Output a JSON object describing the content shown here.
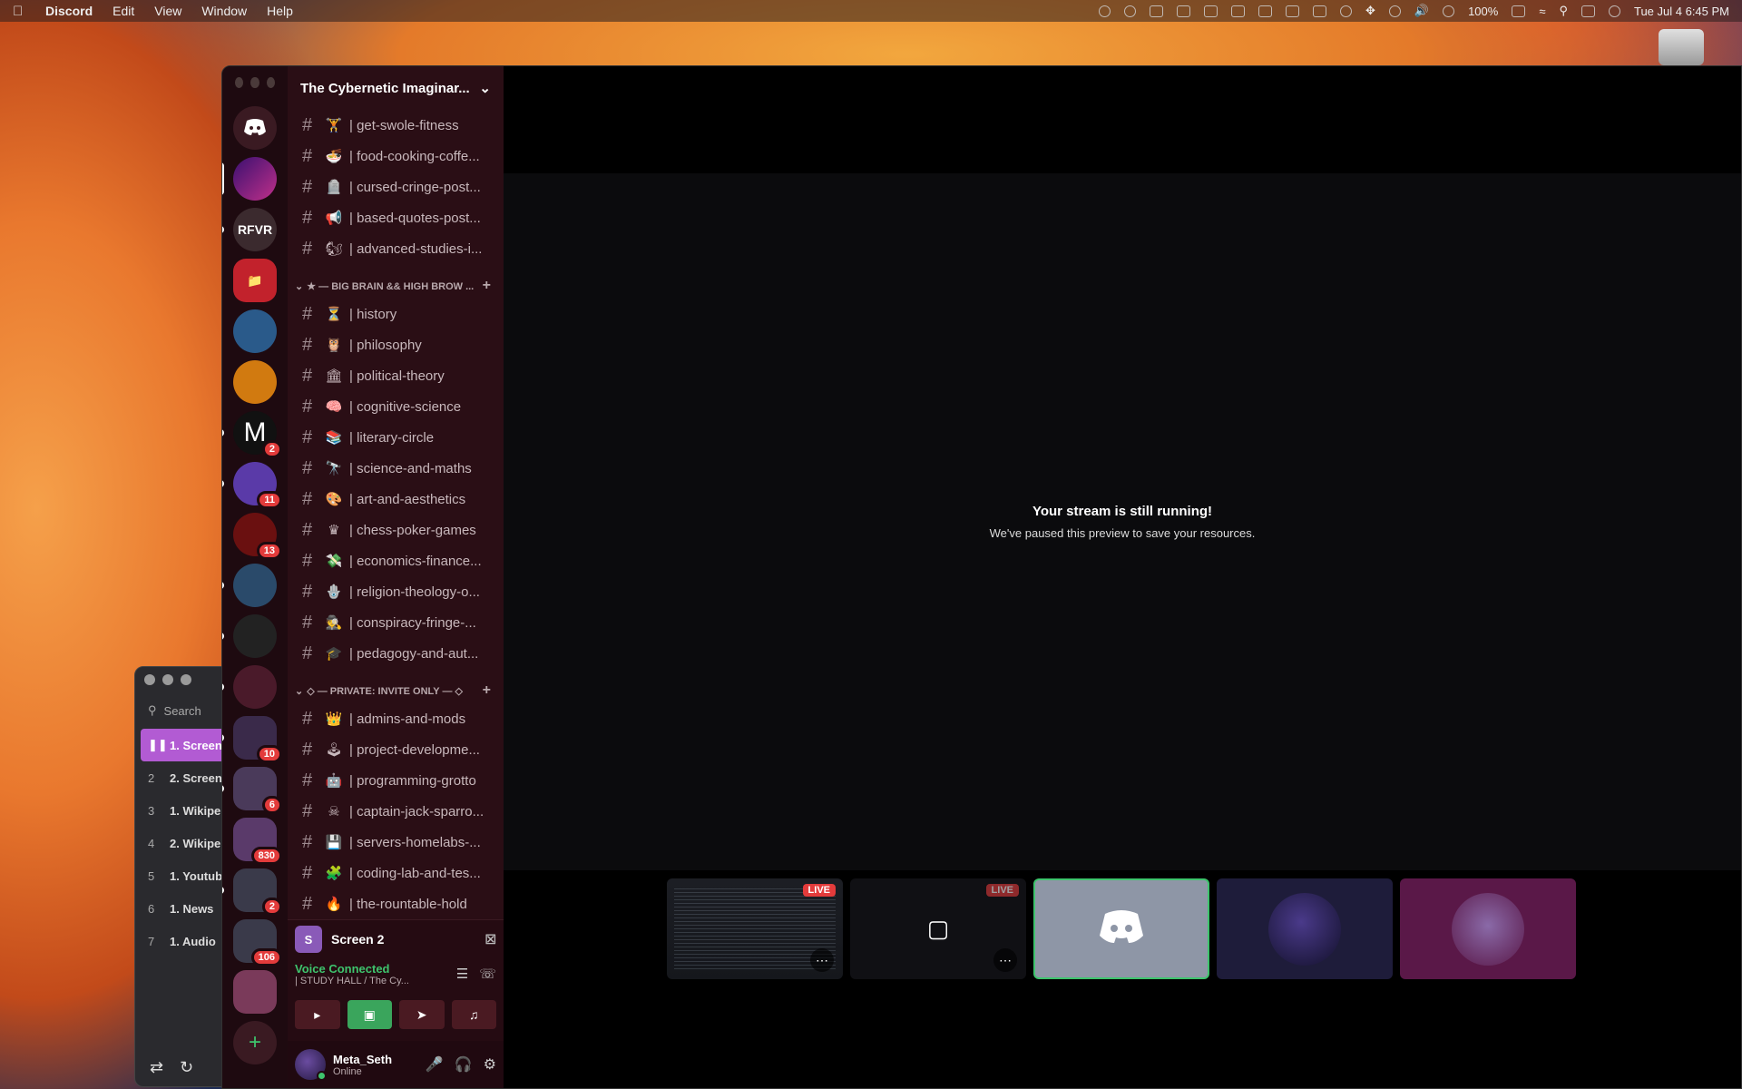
{
  "menubar": {
    "app_name": "Discord",
    "menus": [
      "Edit",
      "View",
      "Window",
      "Help"
    ],
    "battery": "100%",
    "clock": "Tue Jul 4  6:45 PM"
  },
  "music_player": {
    "search_placeholder": "Search",
    "tracks": [
      {
        "num": "",
        "name": "1. Screen",
        "active": true
      },
      {
        "num": "2",
        "name": "2. Screen"
      },
      {
        "num": "3",
        "name": "1. Wikipe"
      },
      {
        "num": "4",
        "name": "2. Wikipe"
      },
      {
        "num": "5",
        "name": "1. Youtub"
      },
      {
        "num": "6",
        "name": "1. News"
      },
      {
        "num": "7",
        "name": "1. Audio"
      }
    ]
  },
  "guilds": [
    {
      "label": "RFVR",
      "color": "#3b2a2e"
    },
    {
      "label": "",
      "color": "#c2222c",
      "icon": "folder"
    },
    {
      "label": "",
      "color": "#2a5a8a"
    },
    {
      "label": "",
      "color": "#d17a10"
    },
    {
      "label": "M",
      "color": "#111",
      "badge": "2"
    },
    {
      "label": "",
      "color": "#5a3aa8",
      "badge": "11"
    },
    {
      "label": "",
      "color": "#6a1010",
      "badge": "13"
    },
    {
      "label": "",
      "color": "#2a4a6a"
    },
    {
      "label": "",
      "color": "#222"
    },
    {
      "label": "",
      "color": "#4a1a2a"
    },
    {
      "label": "",
      "color": "#3a2a4a",
      "badge": "10"
    },
    {
      "label": "",
      "color": "#4a3a5a",
      "badge": "6"
    },
    {
      "label": "",
      "color": "#5a3a6a",
      "badge": "830"
    },
    {
      "label": "",
      "color": "#3a3a4a",
      "badge": "2"
    },
    {
      "label": "",
      "color": "#3a3a4a",
      "badge": "106"
    }
  ],
  "server": {
    "name": "The Cybernetic Imaginar...",
    "channels_top": [
      {
        "emoji": "🏋",
        "name": "| get-swole-fitness"
      },
      {
        "emoji": "🍜",
        "name": "| food-cooking-coffe..."
      },
      {
        "emoji": "🪦",
        "name": "| cursed-cringe-post..."
      },
      {
        "emoji": "📢",
        "name": "| based-quotes-post..."
      },
      {
        "emoji": "🐿",
        "name": "| advanced-studies-i..."
      }
    ],
    "category1": "★ — BIG BRAIN && HIGH BROW ...",
    "channels_mid": [
      {
        "emoji": "⏳",
        "name": "| history"
      },
      {
        "emoji": "🦉",
        "name": "| philosophy"
      },
      {
        "emoji": "🏛",
        "name": "| political-theory"
      },
      {
        "emoji": "🧠",
        "name": "| cognitive-science"
      },
      {
        "emoji": "📚",
        "name": "| literary-circle"
      },
      {
        "emoji": "🔭",
        "name": "| science-and-maths"
      },
      {
        "emoji": "🎨",
        "name": "| art-and-aesthetics"
      },
      {
        "emoji": "♛",
        "name": "| chess-poker-games"
      },
      {
        "emoji": "💸",
        "name": "| economics-finance..."
      },
      {
        "emoji": "🪬",
        "name": "| religion-theology-o..."
      },
      {
        "emoji": "🕵",
        "name": "| conspiracy-fringe-..."
      },
      {
        "emoji": "🎓",
        "name": "| pedagogy-and-aut..."
      }
    ],
    "category2": "◇ — PRIVATE: INVITE ONLY — ◇",
    "channels_private": [
      {
        "emoji": "👑",
        "name": "| admins-and-mods"
      },
      {
        "emoji": "🕹",
        "name": "| project-developme..."
      },
      {
        "emoji": "🤖",
        "name": "| programming-grotto"
      },
      {
        "emoji": "☠",
        "name": "| captain-jack-sparro..."
      },
      {
        "emoji": "💾",
        "name": "| servers-homelabs-..."
      },
      {
        "emoji": "🧩",
        "name": "| coding-lab-and-tes..."
      },
      {
        "emoji": "🔥",
        "name": "| the-rountable-hold"
      }
    ]
  },
  "rtc": {
    "screen_label": "Screen 2",
    "screen_initial": "S",
    "voice_status": "Voice Connected",
    "voice_channel": "| STUDY HALL / The Cy..."
  },
  "user": {
    "name": "Meta_Seth",
    "status": "Online"
  },
  "stage": {
    "title": "Your stream is still running!",
    "subtitle": "We've paused this preview to save your resources.",
    "live_label": "LIVE"
  }
}
